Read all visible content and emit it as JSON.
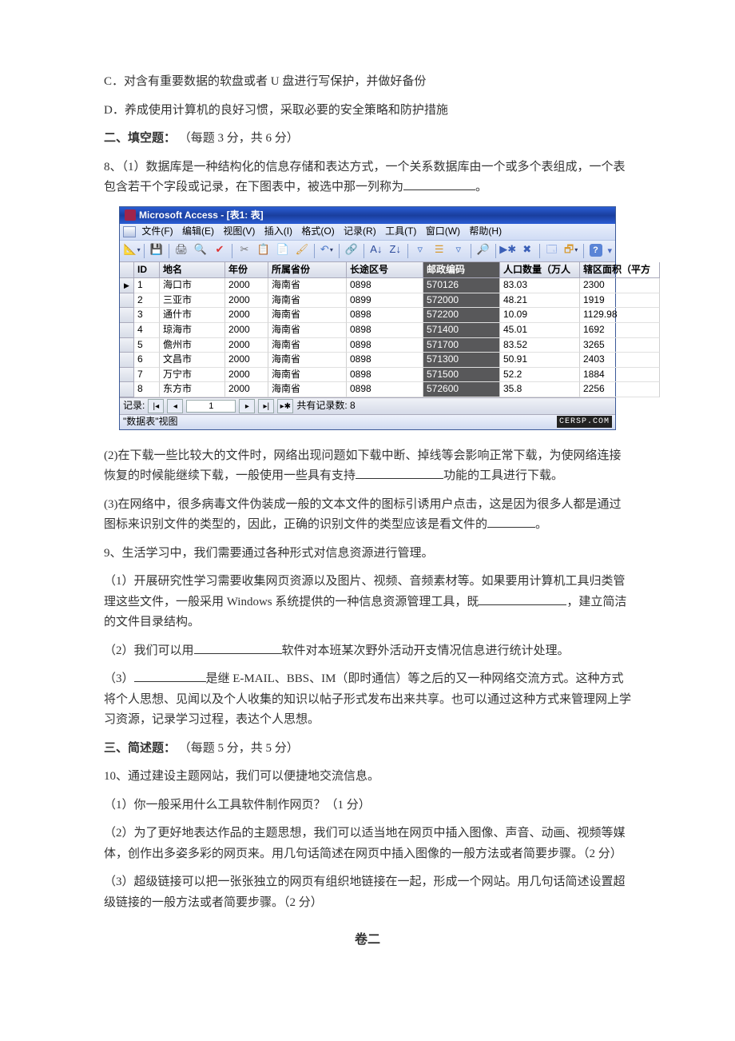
{
  "doc": {
    "optC": "C．对含有重要数据的软盘或者 U 盘进行写保护，并做好备份",
    "optD": "D．养成使用计算机的良好习惯，采取必要的安全策略和防护措施",
    "section2_title": "二、填空题：",
    "section2_score": "（每题 3 分，共 6 分）",
    "q8_1a": "8、（1）数据库是一种结构化的信息存储和表达方式，一个关系数据库由一个或多个表组成，一个表包含若干个字段或记录，在下图表中，被选中那一列称为",
    "q8_1b": "。",
    "q8_2a": "(2)在下载一些比较大的文件时，网络出现问题如下载中断、掉线等会影响正常下载，为使网络连接恢复的时候能继续下载，一般使用一些具有支持",
    "q8_2b": "功能的工具进行下载。",
    "q8_3a": "(3)在网络中，很多病毒文件伪装成一般的文本文件的图标引诱用户点击，这是因为很多人都是通过图标来识别文件的类型的，因此，正确的识别文件的类型应该是看文件的",
    "q8_3b": "。",
    "q9_head": "9、生活学习中，我们需要通过各种形式对信息资源进行管理。",
    "q9_1a": "（1）开展研究性学习需要收集网页资源以及图片、视频、音频素材等。如果要用计算机工具归类管理这些文件，一般采用 Windows 系统提供的一种信息资源管理工具，既",
    "q9_1b": "，建立简洁的文件目录结构。",
    "q9_2a": "（2）我们可以用",
    "q9_2b": "软件对本班某次野外活动开支情况信息进行统计处理。",
    "q9_3a": "（3）",
    "q9_3b": "是继 E-MAIL、BBS、IM（即时通信）等之后的又一种网络交流方式。这种方式将个人思想、见闻以及个人收集的知识以帖子形式发布出来共享。也可以通过这种方式来管理网上学习资源，记录学习过程，表达个人思想。",
    "section3_title": "三、简述题：",
    "section3_score": "（每题 5 分，共 5 分）",
    "q10_head": "10、通过建设主题网站，我们可以便捷地交流信息。",
    "q10_1": "（1）你一般采用什么工具软件制作网页？（1 分）",
    "q10_2": "（2）为了更好地表达作品的主题思想，我们可以适当地在网页中插入图像、声音、动画、视频等媒体，创作出多姿多彩的网页来。用几句话简述在网页中插入图像的一般方法或者简要步骤。（2 分）",
    "q10_3": "（3）超级链接可以把一张张独立的网页有组织地链接在一起，形成一个网站。用几句话简述设置超级链接的一般方法或者简要步骤。（2 分）",
    "paper2": "卷二"
  },
  "access": {
    "title": "Microsoft Access - [表1: 表]",
    "menus": {
      "file": "文件(F)",
      "edit": "编辑(E)",
      "view": "视图(V)",
      "insert": "插入(I)",
      "format": "格式(O)",
      "records": "记录(R)",
      "tools": "工具(T)",
      "window": "窗口(W)",
      "help": "帮助(H)"
    },
    "headers": [
      "",
      "ID",
      "地名",
      "年份",
      "所属省份",
      "长途区号",
      "邮政编码",
      "人口数量（万人",
      "辖区面积（平方"
    ],
    "rows": [
      {
        "id": "1",
        "name": "海口市",
        "year": "2000",
        "prov": "海南省",
        "ldcode": "0898",
        "postal": "570126",
        "pop": "83.03",
        "area": "2300"
      },
      {
        "id": "2",
        "name": "三亚市",
        "year": "2000",
        "prov": "海南省",
        "ldcode": "0899",
        "postal": "572000",
        "pop": "48.21",
        "area": "1919"
      },
      {
        "id": "3",
        "name": "通什市",
        "year": "2000",
        "prov": "海南省",
        "ldcode": "0898",
        "postal": "572200",
        "pop": "10.09",
        "area": "1129.98"
      },
      {
        "id": "4",
        "name": "琼海市",
        "year": "2000",
        "prov": "海南省",
        "ldcode": "0898",
        "postal": "571400",
        "pop": "45.01",
        "area": "1692"
      },
      {
        "id": "5",
        "name": "儋州市",
        "year": "2000",
        "prov": "海南省",
        "ldcode": "0898",
        "postal": "571700",
        "pop": "83.52",
        "area": "3265"
      },
      {
        "id": "6",
        "name": "文昌市",
        "year": "2000",
        "prov": "海南省",
        "ldcode": "0898",
        "postal": "571300",
        "pop": "50.91",
        "area": "2403"
      },
      {
        "id": "7",
        "name": "万宁市",
        "year": "2000",
        "prov": "海南省",
        "ldcode": "0898",
        "postal": "571500",
        "pop": "52.2",
        "area": "1884"
      },
      {
        "id": "8",
        "name": "东方市",
        "year": "2000",
        "prov": "海南省",
        "ldcode": "0898",
        "postal": "572600",
        "pop": "35.8",
        "area": "2256"
      }
    ],
    "rec_label": "记录:",
    "rec_current": "1",
    "rec_total": "共有记录数: 8",
    "status_left": "\"数据表\"视图",
    "status_right": "CERSP.COM"
  },
  "chart_data": {
    "type": "table",
    "title": "表1: 表",
    "columns": [
      "ID",
      "地名",
      "年份",
      "所属省份",
      "长途区号",
      "邮政编码",
      "人口数量（万人）",
      "辖区面积（平方）"
    ],
    "rows": [
      [
        1,
        "海口市",
        2000,
        "海南省",
        "0898",
        "570126",
        83.03,
        2300
      ],
      [
        2,
        "三亚市",
        2000,
        "海南省",
        "0899",
        "572000",
        48.21,
        1919
      ],
      [
        3,
        "通什市",
        2000,
        "海南省",
        "0898",
        "572200",
        10.09,
        1129.98
      ],
      [
        4,
        "琼海市",
        2000,
        "海南省",
        "0898",
        "571400",
        45.01,
        1692
      ],
      [
        5,
        "儋州市",
        2000,
        "海南省",
        "0898",
        "571700",
        83.52,
        3265
      ],
      [
        6,
        "文昌市",
        2000,
        "海南省",
        "0898",
        "571300",
        50.91,
        2403
      ],
      [
        7,
        "万宁市",
        2000,
        "海南省",
        "0898",
        "571500",
        52.2,
        1884
      ],
      [
        8,
        "东方市",
        2000,
        "海南省",
        "0898",
        "572600",
        35.8,
        2256
      ]
    ]
  }
}
